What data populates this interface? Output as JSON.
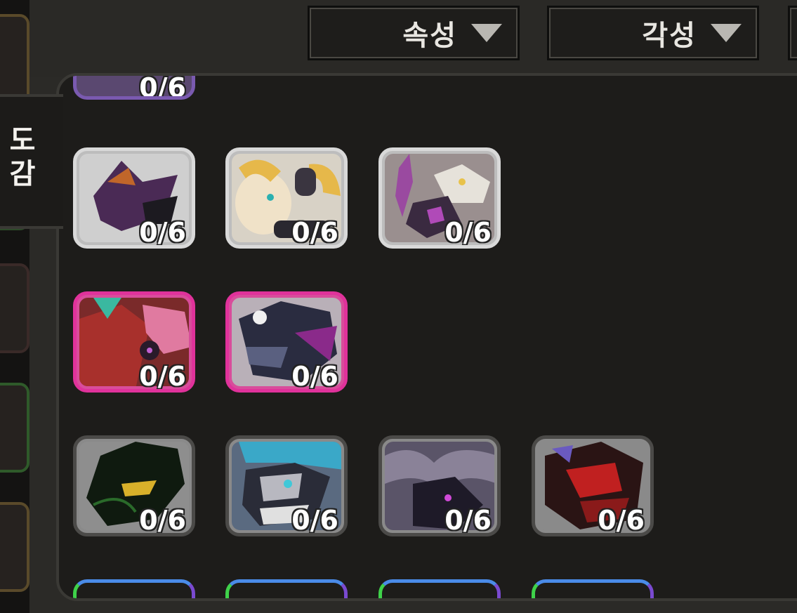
{
  "filters": {
    "attribute": "속성",
    "awakening": "각성"
  },
  "tab": {
    "label": "도감"
  },
  "cards": [
    {
      "count": "0/6",
      "frame": "white",
      "art": "purple-dragon"
    },
    {
      "count": "0/6",
      "frame": "white",
      "art": "golden-ram"
    },
    {
      "count": "0/6",
      "frame": "white",
      "art": "skull-beast"
    },
    {
      "count": "0/6",
      "frame": "pink",
      "art": "red-tiger"
    },
    {
      "count": "0/6",
      "frame": "pink",
      "art": "dark-hydra"
    },
    {
      "count": "0/6",
      "frame": "dark",
      "art": "green-wolf"
    },
    {
      "count": "0/6",
      "frame": "dark",
      "art": "masked-dragon"
    },
    {
      "count": "0/6",
      "frame": "dark",
      "art": "shadow-wolf"
    },
    {
      "count": "0/6",
      "frame": "dark",
      "art": "red-beast"
    }
  ],
  "top_partial_count": "0/6",
  "colors": {
    "pink_frame": "#e0329b",
    "white_frame": "#d9d9d9",
    "dark_frame": "#4b4a48",
    "rainbow_frame": [
      "#3fd24a",
      "#4a8be8",
      "#7a4ad0"
    ]
  }
}
